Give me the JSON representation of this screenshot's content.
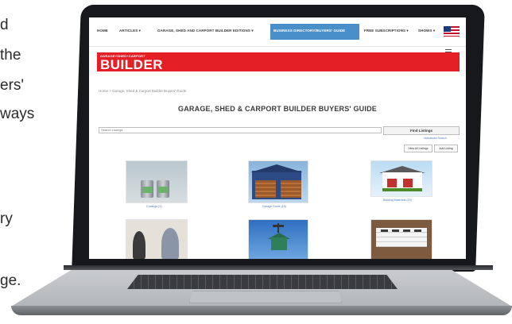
{
  "background_text": {
    "lines": [
      "d",
      "the",
      "ers'",
      "ways",
      "ry",
      "ge."
    ]
  },
  "nav": {
    "items": [
      "HOME",
      "ARTICLES ▾",
      "GARAGE, SHED AND CARPORT BUILDER EDITIONS ▾",
      "BUSINESS DIRECTORY/BUYERS' GUIDE",
      "FREE SUBSCRIPTIONS ▾",
      "SHOWS ▾"
    ]
  },
  "brand": {
    "tagline": "GARAGE+SHED+CARPORT",
    "logo": "BUILDER"
  },
  "breadcrumb": "Home  >  Garage, Shed & Carport Builder Buyers' Guide",
  "page_title": "GARAGE, SHED & CARPORT BUILDER BUYERS' GUIDE",
  "search": {
    "placeholder": "Search Listings",
    "button": "Find Listings",
    "advanced_link": "+Advanced Search"
  },
  "actions": {
    "view_all": "View All Listings",
    "add": "Add Listing"
  },
  "listings": [
    {
      "caption": "Coatings (4)"
    },
    {
      "caption": "Garage Doors (15)"
    },
    {
      "caption": "Building Materials (29)"
    },
    {
      "caption": ""
    },
    {
      "caption": ""
    },
    {
      "caption": ""
    }
  ],
  "colors": {
    "brand_red": "#e41f26",
    "nav_active": "#4a90c8",
    "link_blue": "#4a7ab8"
  }
}
